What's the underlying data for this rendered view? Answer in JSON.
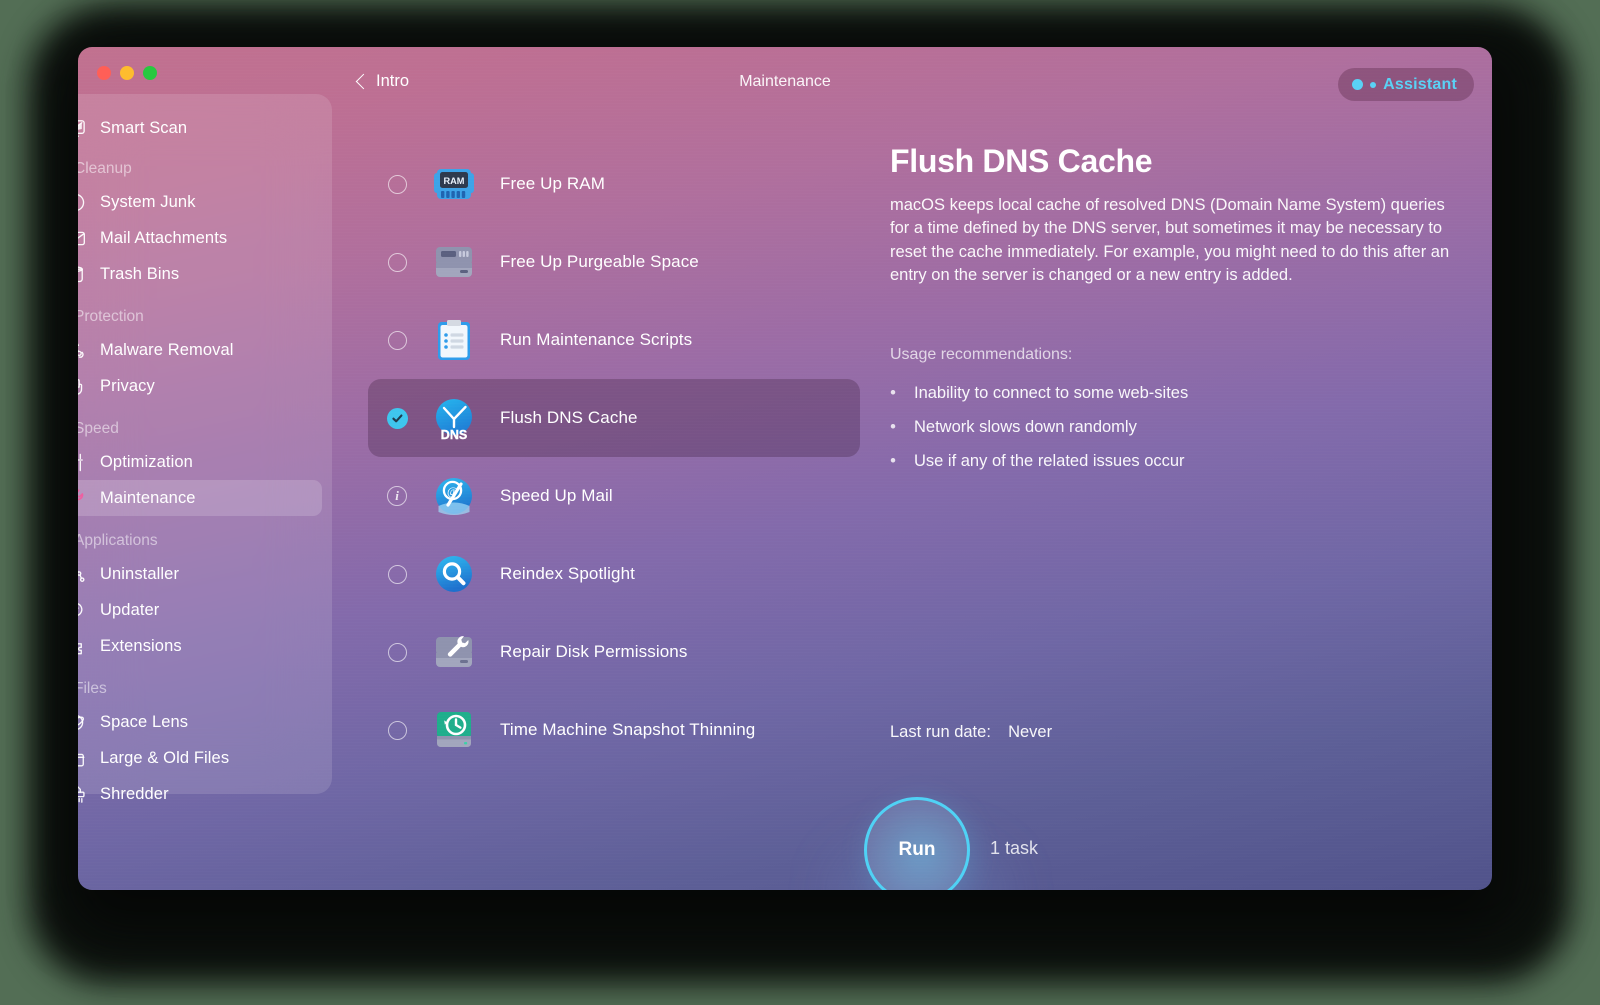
{
  "window": {
    "traffic_lights": [
      {
        "name": "close",
        "color": "#ff5f57"
      },
      {
        "name": "minimize",
        "color": "#febc2e"
      },
      {
        "name": "zoom",
        "color": "#28c840"
      }
    ]
  },
  "header": {
    "back_label": "Intro",
    "breadcrumb_title": "Maintenance",
    "assistant_label": "Assistant",
    "assistant_color": "#5ad1f5"
  },
  "sidebar": {
    "items": [
      {
        "label": "Smart Scan",
        "icon": "smart-scan-icon",
        "type": "item",
        "selected": false
      },
      {
        "label": "Cleanup",
        "type": "group"
      },
      {
        "label": "System Junk",
        "icon": "system-junk-icon",
        "type": "item",
        "selected": false
      },
      {
        "label": "Mail Attachments",
        "icon": "mail-icon",
        "type": "item",
        "selected": false
      },
      {
        "label": "Trash Bins",
        "icon": "trash-icon",
        "type": "item",
        "selected": false
      },
      {
        "label": "Protection",
        "type": "group"
      },
      {
        "label": "Malware Removal",
        "icon": "biohazard-icon",
        "type": "item",
        "selected": false
      },
      {
        "label": "Privacy",
        "icon": "hand-icon",
        "type": "item",
        "selected": false
      },
      {
        "label": "Speed",
        "type": "group"
      },
      {
        "label": "Optimization",
        "icon": "sliders-icon",
        "type": "item",
        "selected": false
      },
      {
        "label": "Maintenance",
        "icon": "wrench-icon",
        "type": "item",
        "selected": true
      },
      {
        "label": "Applications",
        "type": "group"
      },
      {
        "label": "Uninstaller",
        "icon": "apps-grid-icon",
        "type": "item",
        "selected": false
      },
      {
        "label": "Updater",
        "icon": "update-arrow-icon",
        "type": "item",
        "selected": false
      },
      {
        "label": "Extensions",
        "icon": "puzzle-icon",
        "type": "item",
        "selected": false
      },
      {
        "label": "Files",
        "type": "group"
      },
      {
        "label": "Space Lens",
        "icon": "space-lens-icon",
        "type": "item",
        "selected": false
      },
      {
        "label": "Large & Old Files",
        "icon": "folder-icon",
        "type": "item",
        "selected": false
      },
      {
        "label": "Shredder",
        "icon": "shredder-icon",
        "type": "item",
        "selected": false
      }
    ]
  },
  "tasks": [
    {
      "label": "Free Up RAM",
      "icon": "ram-chip-icon",
      "state": "unchecked"
    },
    {
      "label": "Free Up Purgeable Space",
      "icon": "hard-drive-icon",
      "state": "unchecked"
    },
    {
      "label": "Run Maintenance Scripts",
      "icon": "clipboard-icon",
      "state": "unchecked"
    },
    {
      "label": "Flush DNS Cache",
      "icon": "dns-clock-icon",
      "state": "checked"
    },
    {
      "label": "Speed Up Mail",
      "icon": "mail-speed-icon",
      "state": "info"
    },
    {
      "label": "Reindex Spotlight",
      "icon": "spotlight-search-icon",
      "state": "unchecked"
    },
    {
      "label": "Repair Disk Permissions",
      "icon": "disk-wrench-icon",
      "state": "unchecked"
    },
    {
      "label": "Time Machine Snapshot Thinning",
      "icon": "time-machine-icon",
      "state": "unchecked"
    }
  ],
  "detail": {
    "title": "Flush DNS Cache",
    "description": "macOS keeps local cache of resolved DNS (Domain Name System) queries for a time defined by the DNS server, but sometimes it may be necessary to reset the cache immediately. For example, you might need to do this after an entry on the server is changed or a new entry is added.",
    "usage_heading": "Usage recommendations:",
    "usage_items": [
      "Inability to connect to some web-sites",
      "Network slows down randomly",
      "Use if any of the related issues occur"
    ],
    "last_run_label": "Last run date:",
    "last_run_value": "Never"
  },
  "footer": {
    "run_label": "Run",
    "task_count": "1 task",
    "accent_color": "#4fd2f5"
  }
}
